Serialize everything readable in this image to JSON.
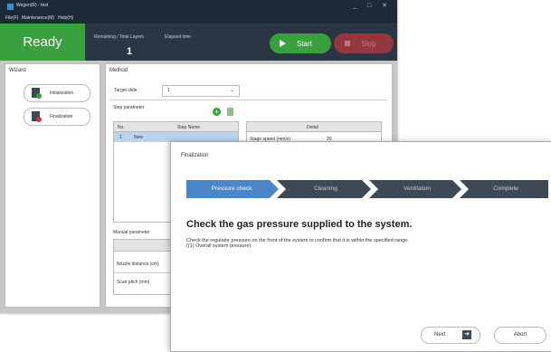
{
  "window": {
    "app_title": "Wegen(R) - test",
    "controls": "_ □ ✕"
  },
  "menu": {
    "file": "File(F)",
    "maintenance": "Maintenance(M)",
    "help": "Help(H)"
  },
  "status": {
    "state": "Ready",
    "remaining_label": "Remaining / Total Layers",
    "remaining_value": "1",
    "elapsed_label": "Elapsed time",
    "start_label": "Start",
    "stop_label": "Stop",
    "colors": {
      "ready": "#3a9f3e",
      "stop": "#a8383f",
      "header": "#2a3644"
    }
  },
  "wizard": {
    "title": "Wizard",
    "buttons": [
      {
        "label": "Initialization",
        "icon": "initialization-icon",
        "color": "#3a9f3e"
      },
      {
        "label": "Finalization",
        "icon": "finalization-icon",
        "color": "#c9383f"
      }
    ]
  },
  "method": {
    "title": "Method",
    "target_slide_label": "Target slide :",
    "target_slide_value": "1",
    "step_parameter_label": "Step parameter",
    "step_table": {
      "headers": [
        "No.",
        "Step Name"
      ],
      "rows": [
        [
          "1",
          "New"
        ]
      ]
    },
    "detail_table": {
      "header": "Detail",
      "rows": [
        [
          "Stage speed (mm/s)",
          "20"
        ]
      ]
    },
    "manual_parameter_label": "Manual parameter",
    "manual_rows": [
      "Nozzle distance (cm)",
      "Scan pitch (mm)"
    ]
  },
  "dialog": {
    "title": "Finalization",
    "steps": [
      {
        "label": "Pressure check",
        "active": true
      },
      {
        "label": "Cleaning",
        "active": false
      },
      {
        "label": "Ventilation",
        "active": false
      },
      {
        "label": "Complete",
        "active": false
      }
    ],
    "step_colors": {
      "active": "#4a86c8",
      "inactive": "#3d4a55"
    },
    "heading": "Check the gas pressure supplied to the system.",
    "line1": "Check the regulator pressure on the front of the system to confirm that it is within the specified range.",
    "line2": "((1) Overall system pressure)",
    "next_label": "Next",
    "abort_label": "Abort"
  }
}
